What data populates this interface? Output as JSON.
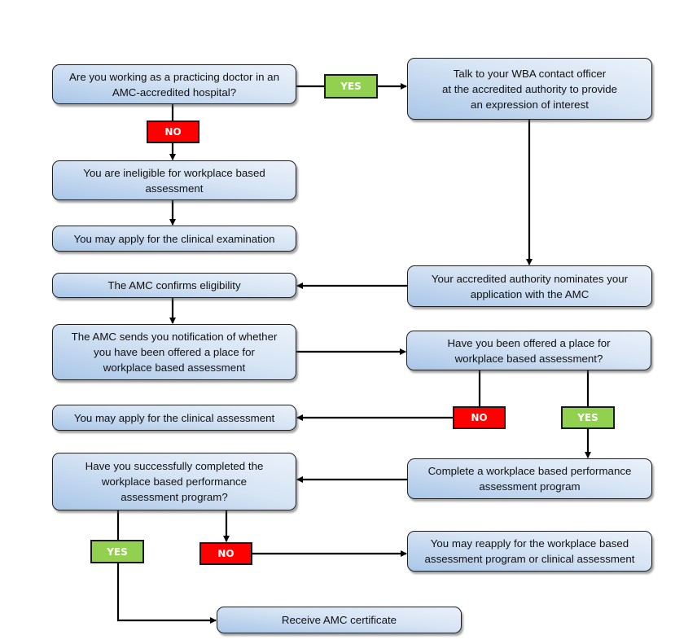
{
  "colors": {
    "yes_tag": "#92d050",
    "no_tag": "#ff0000",
    "box_light": "#eaf1fa",
    "box_dark": "#a9c6e8",
    "line": "#000000"
  },
  "nodes": {
    "q_practicing": "Are you working as a practicing doctor in an\nAMC-accredited hospital?",
    "wba_contact": "Talk to your WBA contact officer\nat the accredited authority to provide\nan expression of interest",
    "ineligible": "You are ineligible for workplace based\nassessment",
    "apply_clinical_exam": "You may apply for the clinical examination",
    "amc_confirms": "The AMC confirms eligibility",
    "authority_nominates": "Your accredited authority nominates your\napplication with the AMC",
    "amc_sends_notification": "The AMC sends you notification of whether\nyou have been offered a place for\nworkplace based assessment",
    "q_offered_place": "Have you been offered a place for\nworkplace based assessment?",
    "apply_clinical_assessment": "You may apply for the clinical assessment",
    "q_completed_program": "Have you successfully completed the\nworkplace based performance\nassessment program?",
    "complete_program": "Complete a workplace based performance\nassessment program",
    "reapply": "You may reapply for the workplace based\nassessment program or clinical assessment",
    "receive_certificate": "Receive AMC certificate"
  },
  "tags": {
    "q1_yes": "YES",
    "q1_no": "NO",
    "q2_no": "NO",
    "q2_yes": "YES",
    "q3_yes": "YES",
    "q3_no": "NO"
  }
}
